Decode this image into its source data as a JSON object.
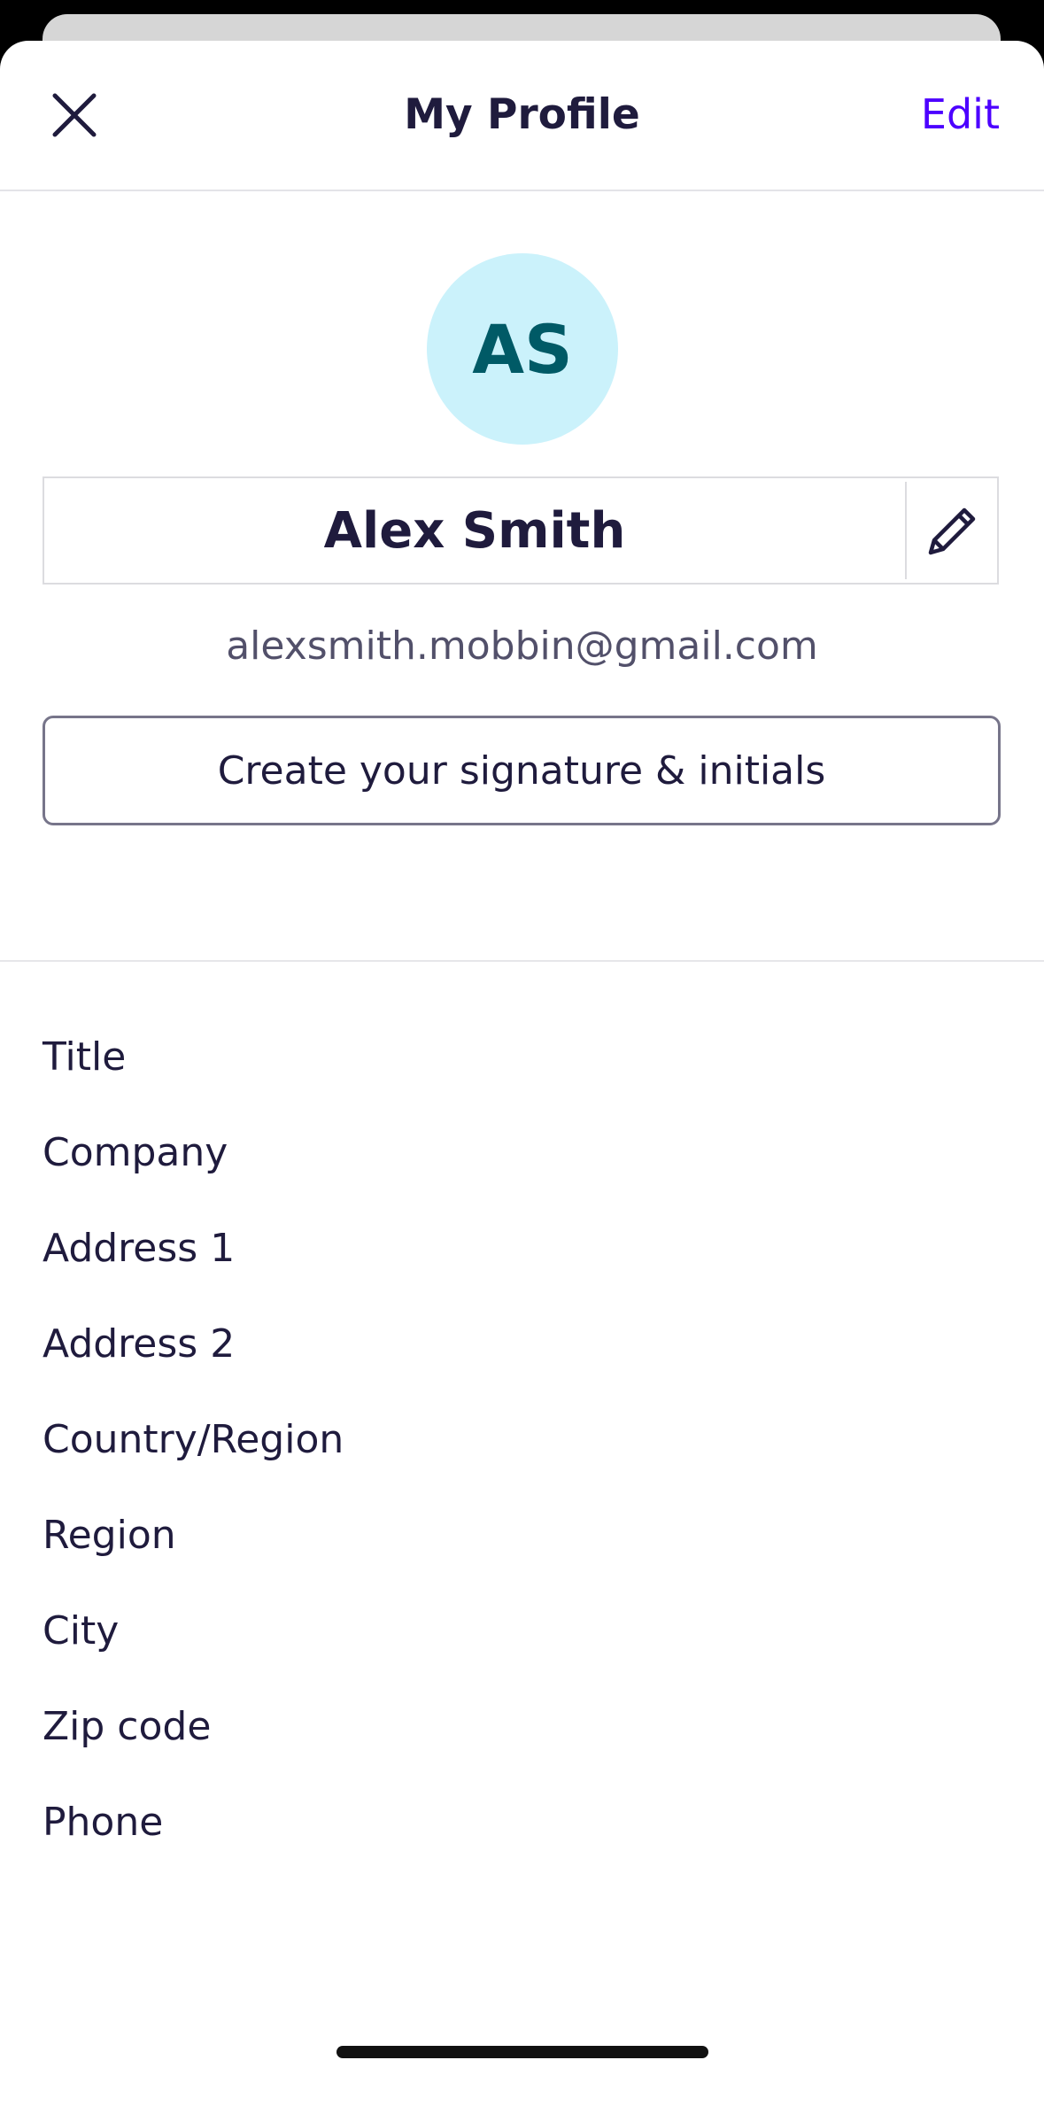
{
  "header": {
    "title": "My Profile",
    "edit_label": "Edit"
  },
  "profile": {
    "initials": "AS",
    "name": "Alex Smith",
    "email": "alexsmith.mobbin@gmail.com",
    "signature_button_label": "Create your signature & initials"
  },
  "fields": [
    {
      "label": "Title"
    },
    {
      "label": "Company"
    },
    {
      "label": "Address 1"
    },
    {
      "label": "Address 2"
    },
    {
      "label": "Country/Region"
    },
    {
      "label": "Region"
    },
    {
      "label": "City"
    },
    {
      "label": "Zip code"
    },
    {
      "label": "Phone"
    }
  ],
  "colors": {
    "accent": "#4c00ff",
    "text_primary": "#1f1b3d",
    "avatar_bg": "#cbf2fb",
    "avatar_text": "#005a66"
  },
  "icons": {
    "close": "close-icon",
    "edit_name": "pencil-icon"
  }
}
